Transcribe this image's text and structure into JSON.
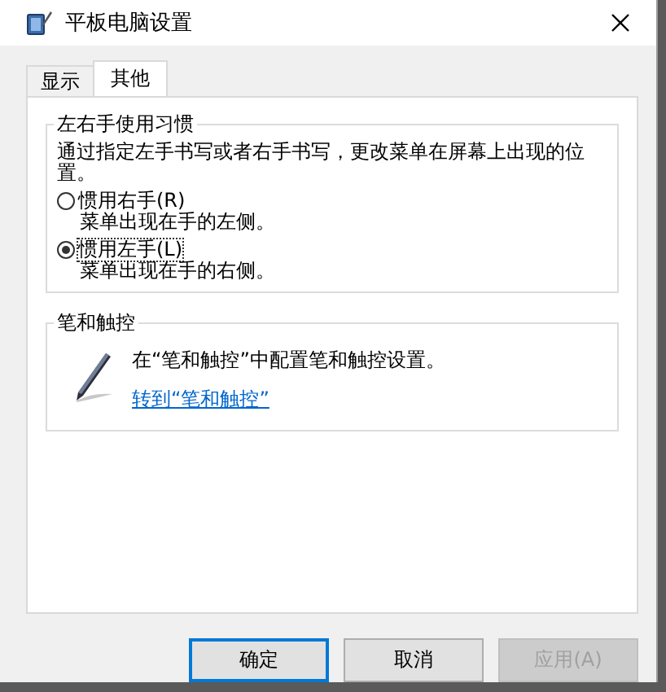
{
  "window": {
    "title": "平板电脑设置"
  },
  "tabs": [
    {
      "label": "显示",
      "selected": false
    },
    {
      "label": "其他",
      "selected": true
    }
  ],
  "handedness_group": {
    "title": "左右手使用习惯",
    "description": "通过指定左手书写或者右手书写，更改菜单在屏幕上出现的位置。",
    "options": [
      {
        "label": "惯用右手(R)",
        "detail": "菜单出现在手的左侧。",
        "selected": false
      },
      {
        "label": "惯用左手(L)",
        "detail": "菜单出现在手的右侧。",
        "selected": true
      }
    ]
  },
  "pen_group": {
    "title": "笔和触控",
    "description": "在“笔和触控”中配置笔和触控设置。",
    "link": "转到“笔和触控”"
  },
  "buttons": [
    {
      "label": "确定",
      "default": true,
      "disabled": false
    },
    {
      "label": "取消",
      "default": false,
      "disabled": false
    },
    {
      "label": "应用(A)",
      "default": false,
      "disabled": true
    }
  ]
}
